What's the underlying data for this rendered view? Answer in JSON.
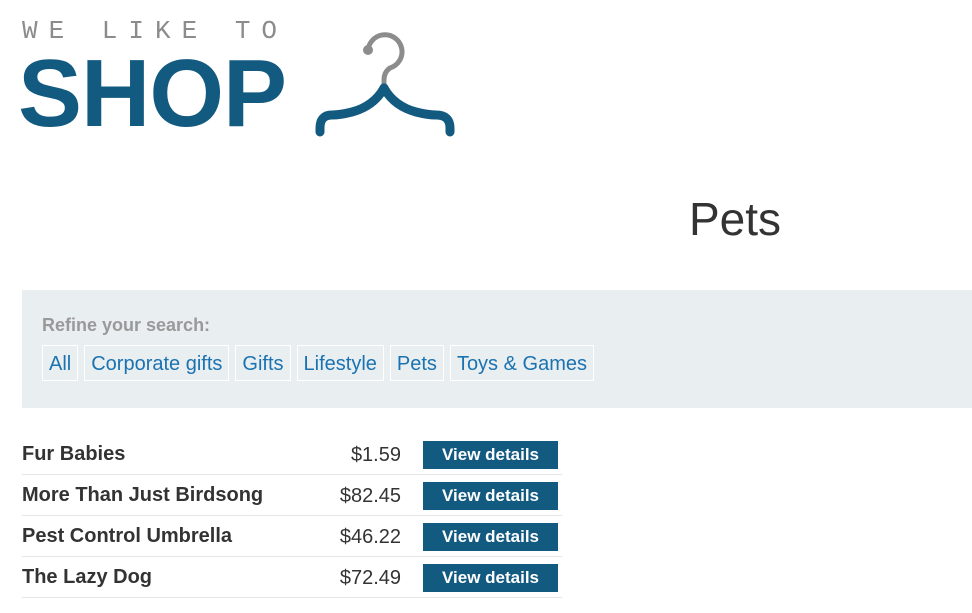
{
  "logo": {
    "tagline": "WE LIKE TO",
    "wordmark": "SHOP",
    "icon": "hanger-icon",
    "tagline_color": "#8c8c8c",
    "brand_color": "#135a80"
  },
  "heading": {
    "title": "Pets"
  },
  "filters": {
    "label": "Refine your search:",
    "items": [
      {
        "label": "All"
      },
      {
        "label": "Corporate gifts"
      },
      {
        "label": "Gifts"
      },
      {
        "label": "Lifestyle"
      },
      {
        "label": "Pets"
      },
      {
        "label": "Toys & Games"
      }
    ],
    "background": "#e9eef1",
    "link_color": "#1a73b0"
  },
  "products": [
    {
      "name": "Fur Babies",
      "price": "$1.59",
      "button": "View details"
    },
    {
      "name": "More Than Just Birdsong",
      "price": "$82.45",
      "button": "View details"
    },
    {
      "name": "Pest Control Umbrella",
      "price": "$46.22",
      "button": "View details"
    },
    {
      "name": "The Lazy Dog",
      "price": "$72.49",
      "button": "View details"
    }
  ]
}
